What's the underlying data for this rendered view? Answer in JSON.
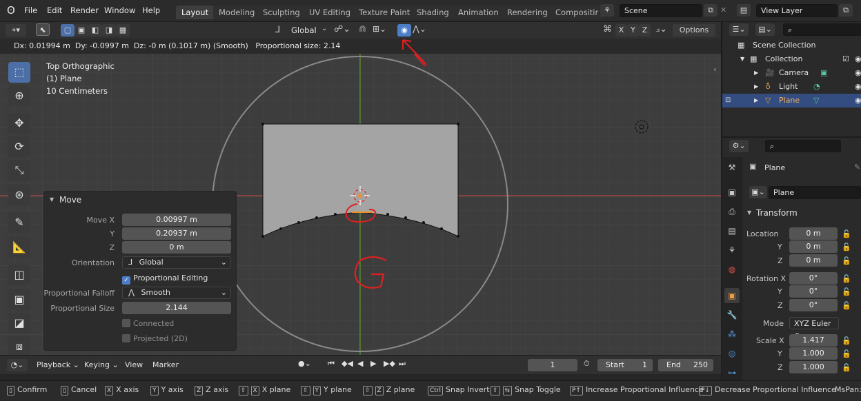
{
  "menubar": {
    "items": [
      "File",
      "Edit",
      "Render",
      "Window",
      "Help"
    ],
    "workspaces": [
      "Layout",
      "Modeling",
      "Sculpting",
      "UV Editing",
      "Texture Paint",
      "Shading",
      "Animation",
      "Rendering",
      "Compositir"
    ],
    "active_workspace": "Layout",
    "scene": "Scene",
    "view_layer": "View Layer"
  },
  "viewport_header": {
    "orientation": "Global",
    "options_label": "Options",
    "axes": [
      "X",
      "Y",
      "Z"
    ]
  },
  "info_bar": {
    "text": "Dx: 0.01994 m  Dy: -0.0997 m  Dz: -0 m (0.1017 m) (Smooth)   Proportional size: 2.14"
  },
  "viewport": {
    "view_name": "Top Orthographic",
    "object_label": "(1) Plane",
    "scale_label": "10 Centimeters"
  },
  "move_panel": {
    "title": "Move",
    "move_x_label": "Move X",
    "move_x": "0.00997 m",
    "y_label": "Y",
    "move_y": "0.20937 m",
    "z_label": "Z",
    "move_z": "0 m",
    "orientation_label": "Orientation",
    "orientation": "Global",
    "proportional_editing_label": "Proportional Editing",
    "proportional_editing": true,
    "falloff_label": "Proportional Falloff",
    "falloff": "Smooth",
    "size_label": "Proportional Size",
    "size": "2.144",
    "connected_label": "Connected",
    "projected_label": "Projected (2D)"
  },
  "outliner": {
    "scene_collection": "Scene Collection",
    "collection": "Collection",
    "items": [
      "Camera",
      "Light",
      "Plane"
    ],
    "selected": "Plane"
  },
  "properties": {
    "object_name": "Plane",
    "data_name": "Plane",
    "transform_label": "Transform",
    "location_label": "Location",
    "location": [
      "0 m",
      "0 m",
      "0 m"
    ],
    "rotation_label": "Rotation X",
    "rotation": [
      "0°",
      "0°",
      "0°"
    ],
    "mode_label": "Mode",
    "mode": "XYZ Euler",
    "scale_label": "Scale X",
    "scale": [
      "1.417",
      "1.000",
      "1.000"
    ],
    "axis_y": "Y",
    "axis_z": "Z"
  },
  "timeline": {
    "playback": "Playback",
    "keying": "Keying",
    "view": "View",
    "marker": "Marker",
    "current_frame": "1",
    "start_label": "Start",
    "start": "1",
    "end_label": "End",
    "end": "250"
  },
  "status_bar": {
    "confirm": "Confirm",
    "cancel": "Cancel",
    "x_axis": "X axis",
    "y_axis": "Y axis",
    "z_axis": "Z axis",
    "x_plane": "X plane",
    "y_plane": "Y plane",
    "z_plane": "Z plane",
    "snap_invert": "Snap Invert",
    "snap_toggle": "Snap Toggle",
    "increase_prop": "Increase Proportional Influence",
    "decrease_prop": "Decrease Proportional Influence",
    "mspan": "MsPan:",
    "key_ctrl": "Ctrl",
    "key_pgup": "P↑",
    "key_pgdn": "P↓"
  },
  "annotations": {
    "handwritten_letter": "G"
  },
  "colors": {
    "accent_blue": "#4d7fc8",
    "selected_row": "#334d80",
    "x_axis_red": "#b04848",
    "y_axis_green": "#5a9a2e",
    "annotation_red": "#e02020"
  }
}
